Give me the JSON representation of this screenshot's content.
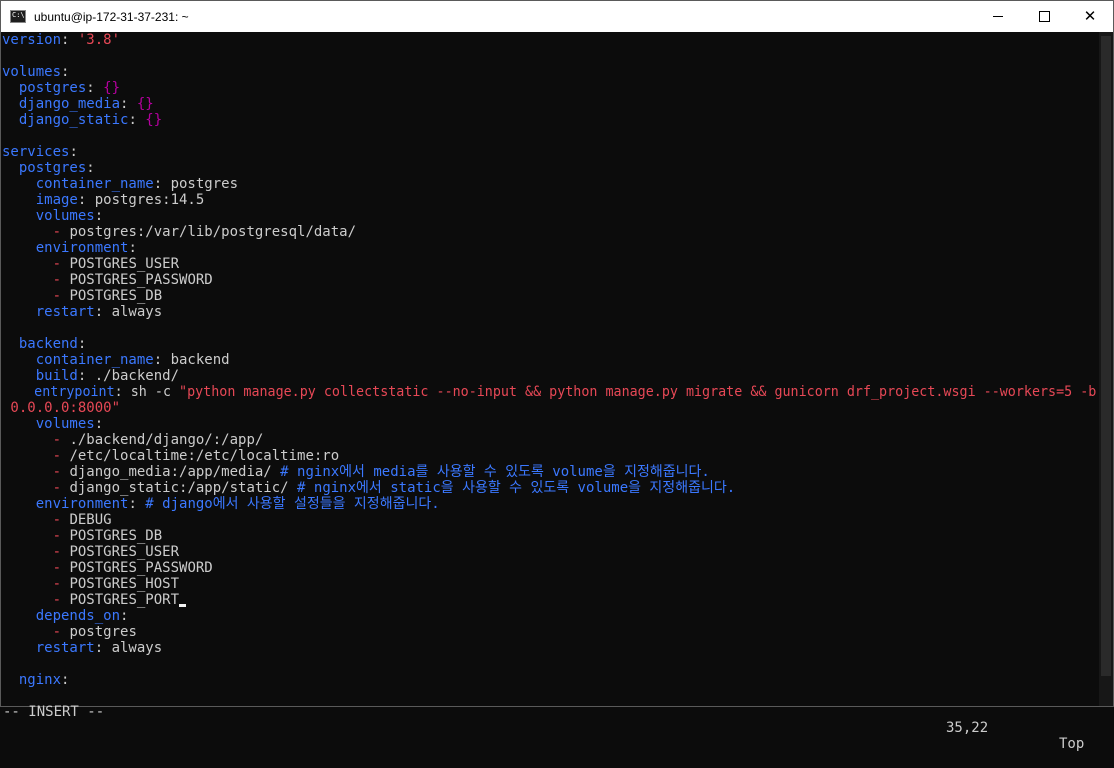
{
  "window": {
    "title": "ubuntu@ip-172-31-37-231: ~",
    "app_icon_text": "C:\\",
    "controls": [
      "minimize-icon",
      "maximize-icon",
      "close-icon"
    ]
  },
  "editor": {
    "lines": [
      [
        {
          "c": "k",
          "t": "version"
        },
        {
          "c": "t",
          "t": ": "
        },
        {
          "c": "s",
          "t": "'3.8'"
        }
      ],
      [],
      [
        {
          "c": "k",
          "t": "volumes"
        },
        {
          "c": "t",
          "t": ":"
        }
      ],
      [
        {
          "c": "k",
          "t": "  postgres"
        },
        {
          "c": "t",
          "t": ": "
        },
        {
          "c": "p",
          "t": "{}"
        }
      ],
      [
        {
          "c": "k",
          "t": "  django_media"
        },
        {
          "c": "t",
          "t": ": "
        },
        {
          "c": "p",
          "t": "{}"
        }
      ],
      [
        {
          "c": "k",
          "t": "  django_static"
        },
        {
          "c": "t",
          "t": ": "
        },
        {
          "c": "p",
          "t": "{}"
        }
      ],
      [],
      [
        {
          "c": "k",
          "t": "services"
        },
        {
          "c": "t",
          "t": ":"
        }
      ],
      [
        {
          "c": "k",
          "t": "  postgres"
        },
        {
          "c": "t",
          "t": ":"
        }
      ],
      [
        {
          "c": "k",
          "t": "    container_name"
        },
        {
          "c": "t",
          "t": ": postgres"
        }
      ],
      [
        {
          "c": "k",
          "t": "    image"
        },
        {
          "c": "t",
          "t": ": postgres:14.5"
        }
      ],
      [
        {
          "c": "k",
          "t": "    volumes"
        },
        {
          "c": "t",
          "t": ":"
        }
      ],
      [
        {
          "c": "t",
          "t": "      "
        },
        {
          "c": "s",
          "t": "-"
        },
        {
          "c": "t",
          "t": " postgres:/var/lib/postgresql/data/"
        }
      ],
      [
        {
          "c": "k",
          "t": "    environment"
        },
        {
          "c": "t",
          "t": ":"
        }
      ],
      [
        {
          "c": "t",
          "t": "      "
        },
        {
          "c": "s",
          "t": "-"
        },
        {
          "c": "t",
          "t": " POSTGRES_USER"
        }
      ],
      [
        {
          "c": "t",
          "t": "      "
        },
        {
          "c": "s",
          "t": "-"
        },
        {
          "c": "t",
          "t": " POSTGRES_PASSWORD"
        }
      ],
      [
        {
          "c": "t",
          "t": "      "
        },
        {
          "c": "s",
          "t": "-"
        },
        {
          "c": "t",
          "t": " POSTGRES_DB"
        }
      ],
      [
        {
          "c": "k",
          "t": "    restart"
        },
        {
          "c": "t",
          "t": ": always"
        }
      ],
      [],
      [
        {
          "c": "k",
          "t": "  backend"
        },
        {
          "c": "t",
          "t": ":"
        }
      ],
      [
        {
          "c": "k",
          "t": "    container_name"
        },
        {
          "c": "t",
          "t": ": backend"
        }
      ],
      [
        {
          "c": "k",
          "t": "    build"
        },
        {
          "c": "t",
          "t": ": ./backend/"
        }
      ],
      [
        {
          "c": "k",
          "t": "    entrypoint"
        },
        {
          "c": "t",
          "t": ": sh -c "
        },
        {
          "c": "s",
          "t": "\"python manage.py collectstatic --no-input && python manage.py migrate && gunicorn drf_project.wsgi --workers=5 -b"
        }
      ],
      [
        {
          "c": "s",
          "t": " 0.0.0.0:8000\""
        }
      ],
      [
        {
          "c": "k",
          "t": "    volumes"
        },
        {
          "c": "t",
          "t": ":"
        }
      ],
      [
        {
          "c": "t",
          "t": "      "
        },
        {
          "c": "s",
          "t": "-"
        },
        {
          "c": "t",
          "t": " ./backend/django/:/app/"
        }
      ],
      [
        {
          "c": "t",
          "t": "      "
        },
        {
          "c": "s",
          "t": "-"
        },
        {
          "c": "t",
          "t": " /etc/localtime:/etc/localtime:ro"
        }
      ],
      [
        {
          "c": "t",
          "t": "      "
        },
        {
          "c": "s",
          "t": "-"
        },
        {
          "c": "t",
          "t": " django_media:/app/media/ "
        },
        {
          "c": "c",
          "t": "# nginx에서 media를 사용할 수 있도록 volume을 지정해줍니다."
        }
      ],
      [
        {
          "c": "t",
          "t": "      "
        },
        {
          "c": "s",
          "t": "-"
        },
        {
          "c": "t",
          "t": " django_static:/app/static/ "
        },
        {
          "c": "c",
          "t": "# nginx에서 static을 사용할 수 있도록 volume을 지정해줍니다."
        }
      ],
      [
        {
          "c": "k",
          "t": "    environment"
        },
        {
          "c": "t",
          "t": ": "
        },
        {
          "c": "c",
          "t": "# django에서 사용할 설정들을 지정해줍니다."
        }
      ],
      [
        {
          "c": "t",
          "t": "      "
        },
        {
          "c": "s",
          "t": "-"
        },
        {
          "c": "t",
          "t": " DEBUG"
        }
      ],
      [
        {
          "c": "t",
          "t": "      "
        },
        {
          "c": "s",
          "t": "-"
        },
        {
          "c": "t",
          "t": " POSTGRES_DB"
        }
      ],
      [
        {
          "c": "t",
          "t": "      "
        },
        {
          "c": "s",
          "t": "-"
        },
        {
          "c": "t",
          "t": " POSTGRES_USER"
        }
      ],
      [
        {
          "c": "t",
          "t": "      "
        },
        {
          "c": "s",
          "t": "-"
        },
        {
          "c": "t",
          "t": " POSTGRES_PASSWORD"
        }
      ],
      [
        {
          "c": "t",
          "t": "      "
        },
        {
          "c": "s",
          "t": "-"
        },
        {
          "c": "t",
          "t": " POSTGRES_HOST"
        }
      ],
      [
        {
          "c": "t",
          "t": "      "
        },
        {
          "c": "s",
          "t": "-"
        },
        {
          "c": "t",
          "t": " POSTGRES_PORT"
        },
        {
          "c": "cursor",
          "t": ""
        }
      ],
      [
        {
          "c": "k",
          "t": "    depends_on"
        },
        {
          "c": "t",
          "t": ":"
        }
      ],
      [
        {
          "c": "t",
          "t": "      "
        },
        {
          "c": "s",
          "t": "-"
        },
        {
          "c": "t",
          "t": " postgres"
        }
      ],
      [
        {
          "c": "k",
          "t": "    restart"
        },
        {
          "c": "t",
          "t": ": always"
        }
      ],
      [],
      [
        {
          "c": "k",
          "t": "  nginx"
        },
        {
          "c": "t",
          "t": ":"
        }
      ]
    ]
  },
  "status": {
    "mode": "-- INSERT --",
    "position": "35,22",
    "scroll": "Top"
  }
}
